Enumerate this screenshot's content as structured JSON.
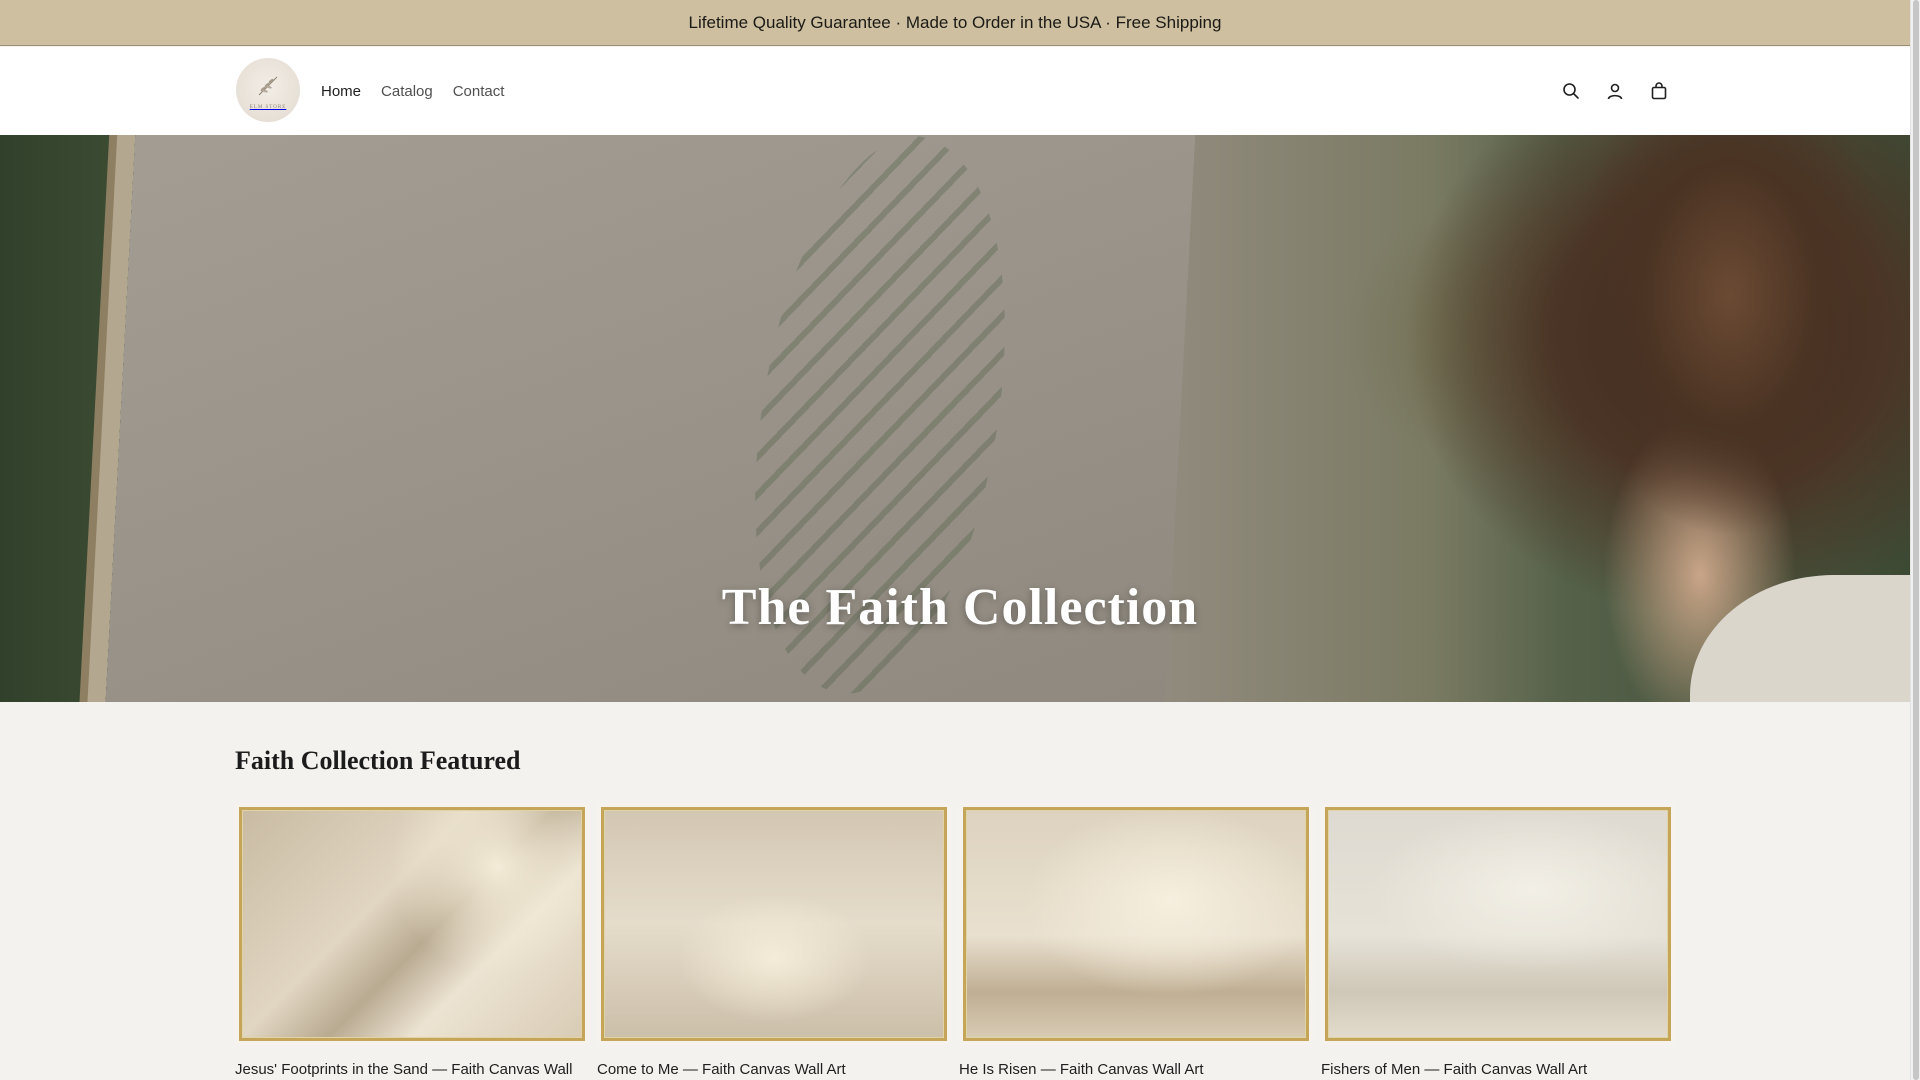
{
  "announcement": {
    "text": "Lifetime Quality Guarantee · Made to Order in the USA · Free Shipping"
  },
  "header": {
    "logo_text": "ELM STORE",
    "nav": [
      {
        "label": "Home",
        "active": true
      },
      {
        "label": "Catalog",
        "active": false
      },
      {
        "label": "Contact",
        "active": false
      }
    ],
    "icons": [
      "search-icon",
      "account-icon",
      "cart-icon"
    ]
  },
  "hero": {
    "title": "The Faith Collection"
  },
  "featured": {
    "title": "Faith Collection Featured",
    "products": [
      {
        "title": "Jesus' Footprints in the Sand — Faith Canvas Wall Art"
      },
      {
        "title": "Come to Me — Faith Canvas Wall Art"
      },
      {
        "title": "He Is Risen — Faith Canvas Wall Art"
      },
      {
        "title": "Fishers of Men — Faith Canvas Wall Art"
      }
    ]
  },
  "colors": {
    "announcement_bg": "#cdbf9f",
    "frame_gold": "#c5a659",
    "page_bg": "#f3f2ee"
  }
}
